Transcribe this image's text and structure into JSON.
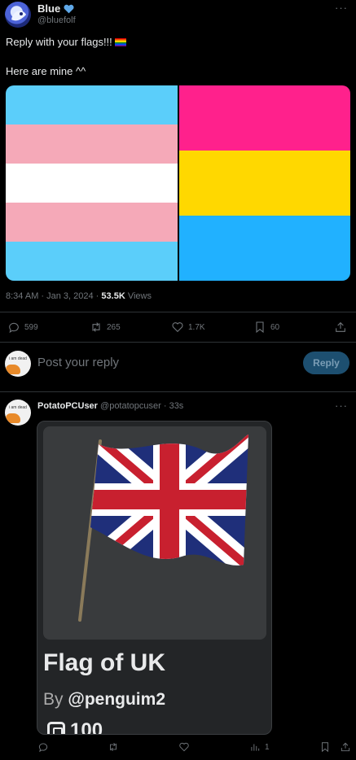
{
  "tweet": {
    "author_name": "Blue",
    "author_handle": "@bluefolf",
    "text_line1": "Reply with your flags!!!",
    "text_line2": "Here are mine ^^",
    "time": "8:34 AM · Jan 3, 2024 · ",
    "views_count": "53.5K",
    "views_label": " Views",
    "more": "···",
    "stats": {
      "replies": "599",
      "reposts": "265",
      "likes": "1.7K",
      "bookmarks": "60"
    },
    "flags": {
      "trans": [
        "#5BCEFA",
        "#F5A9B8",
        "#FFFFFF",
        "#F5A9B8",
        "#5BCEFA"
      ],
      "pan": [
        "#FF218C",
        "#FFD800",
        "#21B1FF"
      ]
    }
  },
  "composer": {
    "placeholder": "Post your reply",
    "reply_button": "Reply",
    "avatar_text": "i am dead"
  },
  "reply": {
    "author_name": "PotatoPCUser",
    "author_handle": "@potatopcuser · 33s",
    "more": "···",
    "card": {
      "title": "Flag of UK",
      "by_prefix": "By ",
      "by_user": "@penguim2",
      "price": "100"
    },
    "stats": {
      "views": "1"
    }
  },
  "colors": {
    "background": "#000000",
    "text": "#e7e9ea",
    "muted": "#71767b",
    "divider": "#2f3336",
    "verified": "#4fa3e0"
  }
}
